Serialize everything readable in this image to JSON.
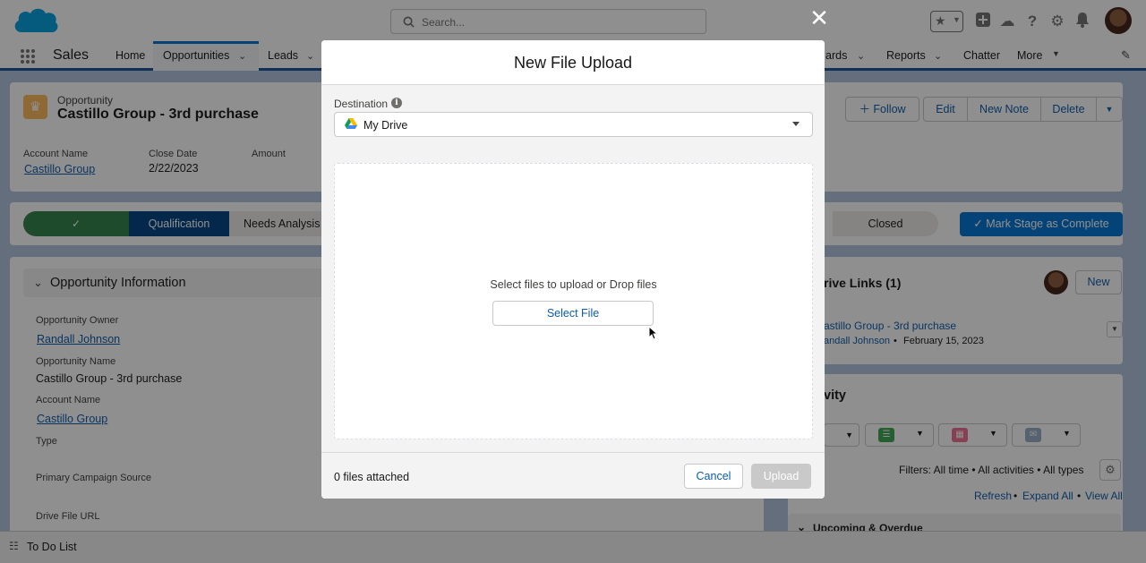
{
  "header": {
    "search_placeholder": "Search..."
  },
  "nav": {
    "app_name": "Sales",
    "items": [
      {
        "label": "Home"
      },
      {
        "label": "Opportunities"
      },
      {
        "label": "Leads"
      },
      {
        "label": "ards"
      },
      {
        "label": "Reports"
      },
      {
        "label": "Chatter"
      },
      {
        "label": "More"
      }
    ]
  },
  "record": {
    "object_type": "Opportunity",
    "title": "Castillo Group - 3rd purchase",
    "fields": [
      {
        "label": "Account Name",
        "value": "Castillo Group"
      },
      {
        "label": "Close Date",
        "value": "2/22/2023"
      },
      {
        "label": "Amount",
        "value": ""
      }
    ],
    "actions": {
      "follow": "Follow",
      "edit": "Edit",
      "new_note": "New Note",
      "delete": "Delete"
    }
  },
  "path": {
    "stages": [
      {
        "label": "Qualification",
        "state": "current"
      },
      {
        "label": "Needs Analysis",
        "state": "incomplete"
      },
      {
        "label": "Closed",
        "state": "incomplete"
      }
    ],
    "mark_complete": "Mark Stage as Complete"
  },
  "details": {
    "section_title": "Opportunity Information",
    "fields": [
      {
        "label": "Opportunity Owner",
        "value": "Randall Johnson"
      },
      {
        "label": "Opportunity Name",
        "value": "Castillo Group - 3rd purchase"
      },
      {
        "label": "Account Name",
        "value": "Castillo Group"
      },
      {
        "label": "Type",
        "value": ""
      },
      {
        "label": "Primary Campaign Source",
        "value": ""
      },
      {
        "label": "Drive File URL",
        "value": ""
      }
    ]
  },
  "drive_links": {
    "title": "rive Links (1)",
    "new_button": "New",
    "item_title": "astillo Group - 3rd purchase",
    "item_owner": "andall Johnson",
    "item_sep": "•",
    "item_date": "February 15, 2023"
  },
  "activity": {
    "title": "vity",
    "filters": "Filters: All time • All activities • All types",
    "refresh": "Refresh",
    "sep": "•",
    "expand_all": "Expand All",
    "view_all": "View All",
    "upcoming": "Upcoming & Overdue"
  },
  "utility_bar": {
    "todo": "To Do List"
  },
  "modal": {
    "title": "New File Upload",
    "destination_label": "Destination",
    "destination_value": "My Drive",
    "drop_text": "Select files to upload or Drop files",
    "select_file": "Select File",
    "files_attached": "0 files attached",
    "cancel": "Cancel",
    "upload": "Upload"
  },
  "colors": {
    "brand": "#0176d3",
    "path_complete": "#2e844a",
    "path_current": "#014486",
    "opportunity_icon": "#fcb95b"
  }
}
